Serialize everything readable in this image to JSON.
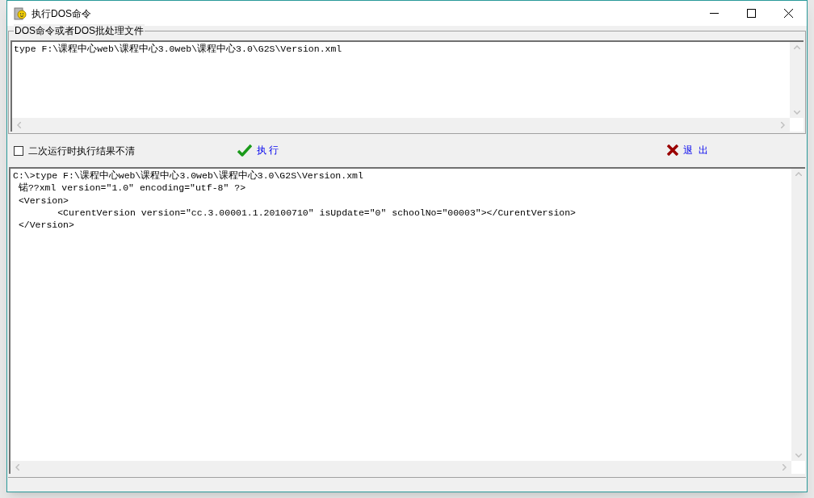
{
  "window": {
    "title": "执行DOS命令"
  },
  "command_group": {
    "label": "DOS命令或者DOS批处理文件",
    "command": "type F:\\课程中心web\\课程中心3.0web\\课程中心3.0\\G2S\\Version.xml"
  },
  "options": {
    "keep_results": {
      "label": "二次运行时执行结果不清",
      "checked": false
    }
  },
  "buttons": [
    {
      "kind": "run",
      "label": "执 行"
    },
    {
      "kind": "exit",
      "label": "退  出"
    }
  ],
  "output": {
    "lines": [
      "C:\\>type F:\\课程中心web\\课程中心3.0web\\课程中心3.0\\G2S\\Version.xml",
      " 锘??xml version=\"1.0\" encoding=\"utf-8\" ?>",
      " <Version>",
      "\t<CurentVersion version=\"cc.3.00001.1.20100710\" isUpdate=\"0\" schoolNo=\"00003\"></CurentVersion>",
      " </Version>"
    ]
  }
}
